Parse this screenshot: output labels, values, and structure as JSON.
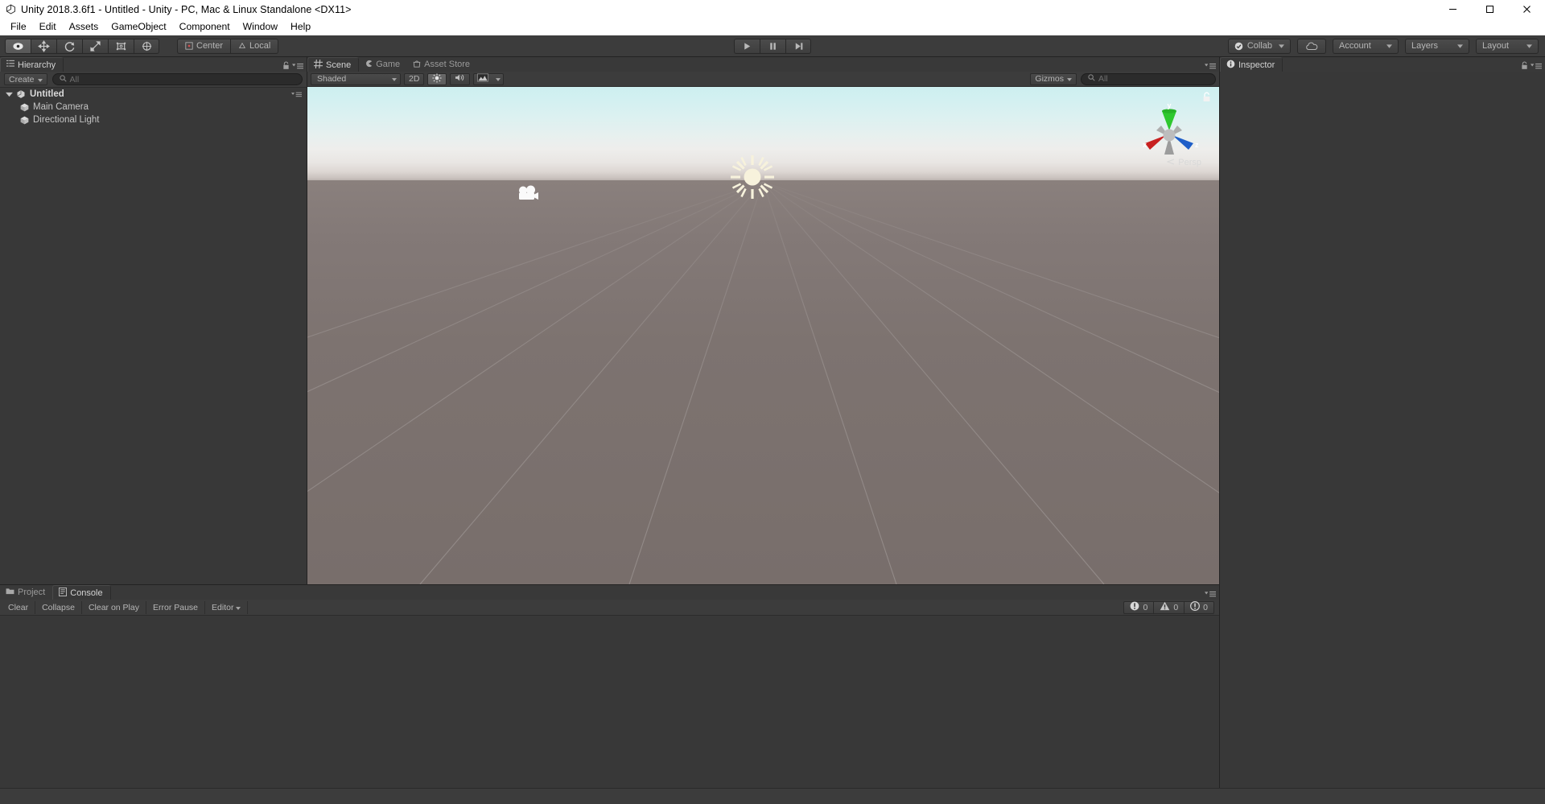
{
  "window": {
    "title": "Unity 2018.3.6f1 - Untitled - Unity - PC, Mac & Linux Standalone <DX11>",
    "logo_icon": "unity-logo-icon",
    "minimize_icon": "minimize-icon",
    "maximize_icon": "maximize-icon",
    "close_icon": "close-icon"
  },
  "menubar": {
    "items": [
      {
        "label": "File"
      },
      {
        "label": "Edit"
      },
      {
        "label": "Assets"
      },
      {
        "label": "GameObject"
      },
      {
        "label": "Component"
      },
      {
        "label": "Window"
      },
      {
        "label": "Help"
      }
    ]
  },
  "toolbar": {
    "tools": [
      {
        "name": "hand-tool",
        "icon": "hand-icon",
        "active": true
      },
      {
        "name": "move-tool",
        "icon": "move-arrows-icon",
        "active": false
      },
      {
        "name": "rotate-tool",
        "icon": "rotate-icon",
        "active": false
      },
      {
        "name": "scale-tool",
        "icon": "scale-icon",
        "active": false
      },
      {
        "name": "rect-tool",
        "icon": "rect-transform-icon",
        "active": false
      },
      {
        "name": "transform-tool",
        "icon": "transform-icon",
        "active": false
      }
    ],
    "pivot_mode": "Center",
    "pivot_rotation": "Local",
    "play": {
      "play_icon": "play-icon",
      "pause_icon": "pause-icon",
      "step_icon": "step-icon"
    },
    "collab": "Collab",
    "cloud_icon": "cloud-icon",
    "account": "Account",
    "layers": "Layers",
    "layout": "Layout"
  },
  "hierarchy": {
    "tab_label": "Hierarchy",
    "tab_icon": "hierarchy-icon",
    "create_label": "Create",
    "search_placeholder": "All",
    "search_value": "",
    "scene_name": "Untitled",
    "objects": [
      {
        "label": "Main Camera",
        "icon": "gameobject-cube-icon"
      },
      {
        "label": "Directional Light",
        "icon": "gameobject-cube-icon"
      }
    ],
    "lock_icon": "lock-icon",
    "menu_icon": "panel-menu-icon"
  },
  "scene": {
    "tabs": [
      {
        "label": "Scene",
        "icon": "scene-grid-icon",
        "active": true
      },
      {
        "label": "Game",
        "icon": "game-pacman-icon",
        "active": false
      },
      {
        "label": "Asset Store",
        "icon": "asset-store-icon",
        "active": false
      }
    ],
    "draw_mode": "Shaded",
    "mode_2d": "2D",
    "lighting_icon": "sun-lighting-icon",
    "lighting_on": true,
    "audio_icon": "audio-icon",
    "effects_icon": "effects-image-icon",
    "gizmos_label": "Gizmos",
    "gizmo_search_placeholder": "All",
    "projection_label": "Persp",
    "axis_labels": {
      "x": "x",
      "y": "y",
      "z": "z"
    },
    "axis_colors": {
      "x": "#c82020",
      "y": "#2ec82e",
      "z": "#1e5ec8"
    },
    "sky_color_top": "#cdeff0",
    "ground_color": "#7d7370",
    "light_gizmo_icon": "directional-light-sun-icon",
    "camera_gizmo_icon": "camera-gizmo-icon",
    "lock_icon": "lock-icon"
  },
  "inspector": {
    "tab_label": "Inspector",
    "tab_icon": "inspector-info-icon",
    "lock_icon": "lock-icon",
    "menu_icon": "panel-menu-icon"
  },
  "console": {
    "tabs": [
      {
        "label": "Project",
        "icon": "folder-icon",
        "active": false
      },
      {
        "label": "Console",
        "icon": "console-icon",
        "active": true
      }
    ],
    "buttons": [
      {
        "label": "Clear",
        "name": "clear-button",
        "has_caret": false
      },
      {
        "label": "Collapse",
        "name": "collapse-button",
        "has_caret": false
      },
      {
        "label": "Clear on Play",
        "name": "clear-on-play-button",
        "has_caret": false
      },
      {
        "label": "Error Pause",
        "name": "error-pause-button",
        "has_caret": false
      },
      {
        "label": "Editor",
        "name": "editor-dropdown",
        "has_caret": true
      }
    ],
    "counters": [
      {
        "name": "error-count",
        "icon": "error-icon",
        "value": "0"
      },
      {
        "name": "warning-count",
        "icon": "warning-icon",
        "value": "0"
      },
      {
        "name": "info-count",
        "icon": "info-icon",
        "value": "0"
      }
    ],
    "menu_icon": "panel-menu-icon"
  }
}
